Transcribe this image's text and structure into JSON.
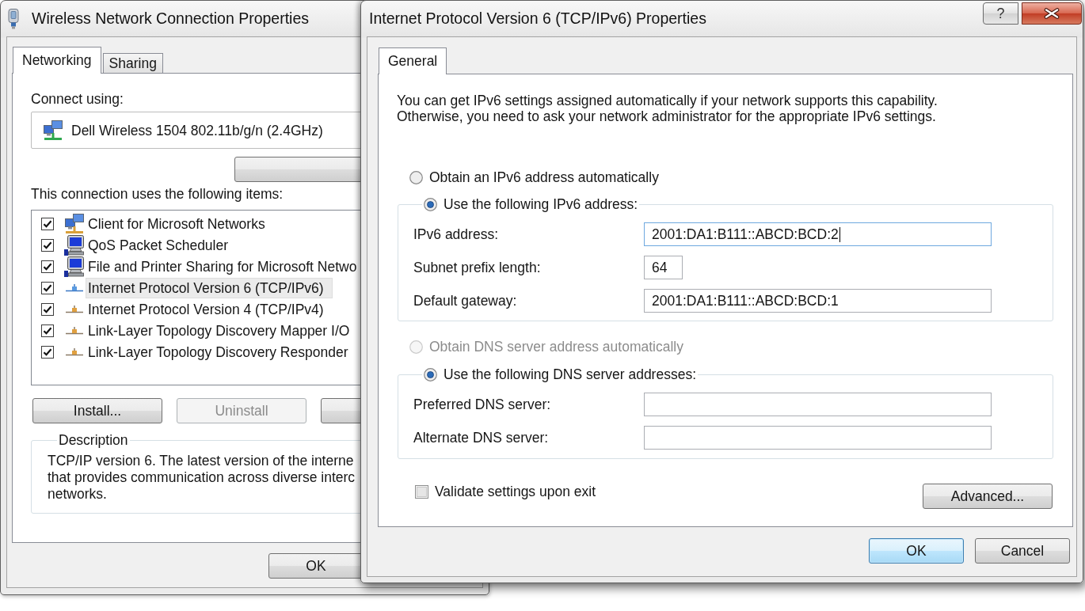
{
  "background_window": {
    "title": "Wireless Network Connection Properties",
    "tabs": [
      {
        "label": "Networking",
        "selected": true
      },
      {
        "label": "Sharing",
        "selected": false
      }
    ],
    "connect_using": {
      "label": "Connect using:",
      "adapter": "Dell Wireless 1504 802.11b/g/n (2.4GHz)"
    },
    "items_label": "This connection uses the following items:",
    "items": [
      {
        "label": "Client for Microsoft Networks",
        "kind": "client",
        "checked": true,
        "selected": false
      },
      {
        "label": "QoS Packet Scheduler",
        "kind": "service",
        "checked": true,
        "selected": false
      },
      {
        "label": "File and Printer Sharing for Microsoft Netwo",
        "kind": "service",
        "checked": true,
        "selected": false
      },
      {
        "label": "Internet Protocol Version 6 (TCP/IPv6)",
        "kind": "protocol",
        "checked": true,
        "selected": true
      },
      {
        "label": "Internet Protocol Version 4 (TCP/IPv4)",
        "kind": "protocol",
        "checked": true,
        "selected": false
      },
      {
        "label": "Link-Layer Topology Discovery Mapper I/O",
        "kind": "protocol",
        "checked": true,
        "selected": false
      },
      {
        "label": "Link-Layer Topology Discovery Responder",
        "kind": "protocol",
        "checked": true,
        "selected": false
      }
    ],
    "install_button": {
      "label": "Install...",
      "disabled": false
    },
    "uninstall_button": {
      "label": "Uninstall",
      "disabled": true
    },
    "description": {
      "title": "Description",
      "lines": [
        "TCP/IP version 6. The latest version of the interne",
        "that provides communication across diverse interc",
        "networks."
      ]
    },
    "ok_button": "OK"
  },
  "dialog": {
    "title": "Internet Protocol Version 6 (TCP/IPv6) Properties",
    "help_button": "?",
    "tabs": [
      {
        "label": "General",
        "selected": true
      }
    ],
    "intro_lines": [
      "You can get IPv6 settings assigned automatically if your network supports this capability.",
      "Otherwise, you need to ask your network administrator for the appropriate IPv6 settings."
    ],
    "sections": [
      {
        "auto_option": {
          "label": "Obtain an IPv6 address automatically",
          "selected": false,
          "disabled": false
        },
        "manual_option": {
          "label": "Use the following IPv6 address:",
          "selected": true,
          "disabled": false
        },
        "fields": [
          {
            "label": "IPv6 address:",
            "value": "2001:DA1:B111::ABCD:BCD:2",
            "kind": "long",
            "focused": true
          },
          {
            "label": "Subnet prefix length:",
            "value": "64",
            "kind": "short",
            "focused": false
          },
          {
            "label": "Default gateway:",
            "value": "2001:DA1:B111::ABCD:BCD:1",
            "kind": "long",
            "focused": false
          }
        ]
      },
      {
        "auto_option": {
          "label": "Obtain DNS server address automatically",
          "selected": false,
          "disabled": true
        },
        "manual_option": {
          "label": "Use the following DNS server addresses:",
          "selected": true,
          "disabled": false
        },
        "fields": [
          {
            "label": "Preferred DNS server:",
            "kind": "long",
            "focused": false
          },
          {
            "label": "Alternate DNS server:",
            "kind": "long",
            "focused": false
          }
        ]
      }
    ],
    "validate": {
      "label": "Validate settings upon exit",
      "checked": false
    },
    "advanced_button": "Advanced...",
    "ok_button": {
      "label": "OK",
      "default": true
    },
    "cancel_button": {
      "label": "Cancel",
      "default": false
    }
  }
}
